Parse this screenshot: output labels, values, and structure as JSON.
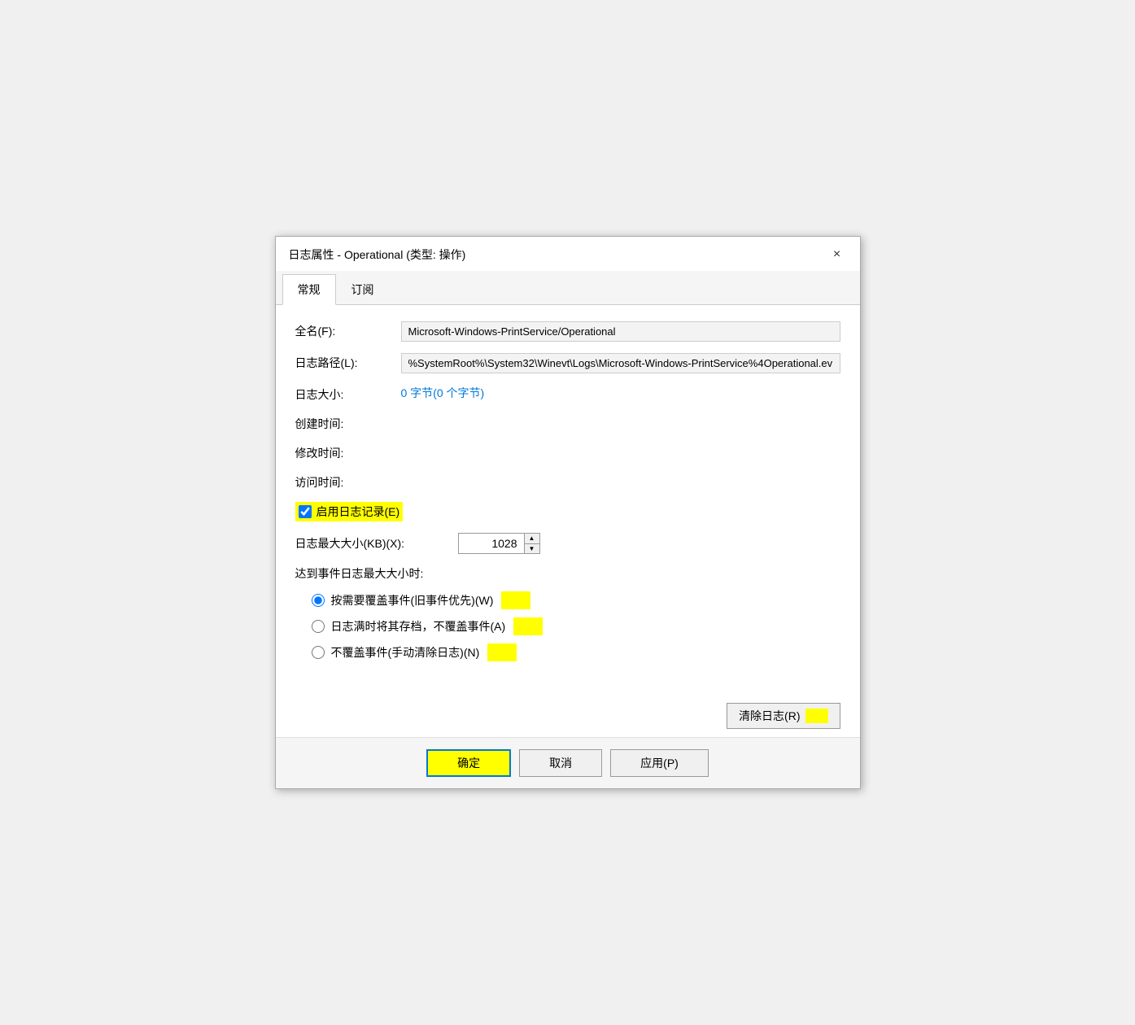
{
  "dialog": {
    "title": "日志属性 - Operational (类型: 操作)",
    "close_label": "×"
  },
  "tabs": [
    {
      "id": "general",
      "label": "常规",
      "active": true
    },
    {
      "id": "subscribe",
      "label": "订阅",
      "active": false
    }
  ],
  "fields": {
    "full_name_label": "全名(F):",
    "full_name_value": "Microsoft-Windows-PrintService/Operational",
    "log_path_label": "日志路径(L):",
    "log_path_value": "%SystemRoot%\\System32\\Winevt\\Logs\\Microsoft-Windows-PrintService%4Operational.ev",
    "log_size_label": "日志大小:",
    "log_size_value": "0 字节(0 个字节)",
    "created_label": "创建时间:",
    "created_value": "",
    "modified_label": "修改时间:",
    "modified_value": "",
    "accessed_label": "访问时间:",
    "accessed_value": ""
  },
  "enable_logging": {
    "label": "启用日志记录(E)",
    "checked": true
  },
  "max_size": {
    "label": "日志最大大小(KB)(X):",
    "value": "1028"
  },
  "when_max": {
    "label": "达到事件日志最大大小时:"
  },
  "radio_options": [
    {
      "id": "overwrite",
      "label": "按需要覆盖事件(旧事件优先)(W)",
      "checked": true
    },
    {
      "id": "archive",
      "label": "日志满时将其存档，不覆盖事件(A)",
      "checked": false
    },
    {
      "id": "no_overwrite",
      "label": "不覆盖事件(手动清除日志)(N)",
      "checked": false
    }
  ],
  "buttons": {
    "clear_log": "清除日志(R)",
    "ok": "确定",
    "cancel": "取消",
    "apply": "应用(P)"
  }
}
